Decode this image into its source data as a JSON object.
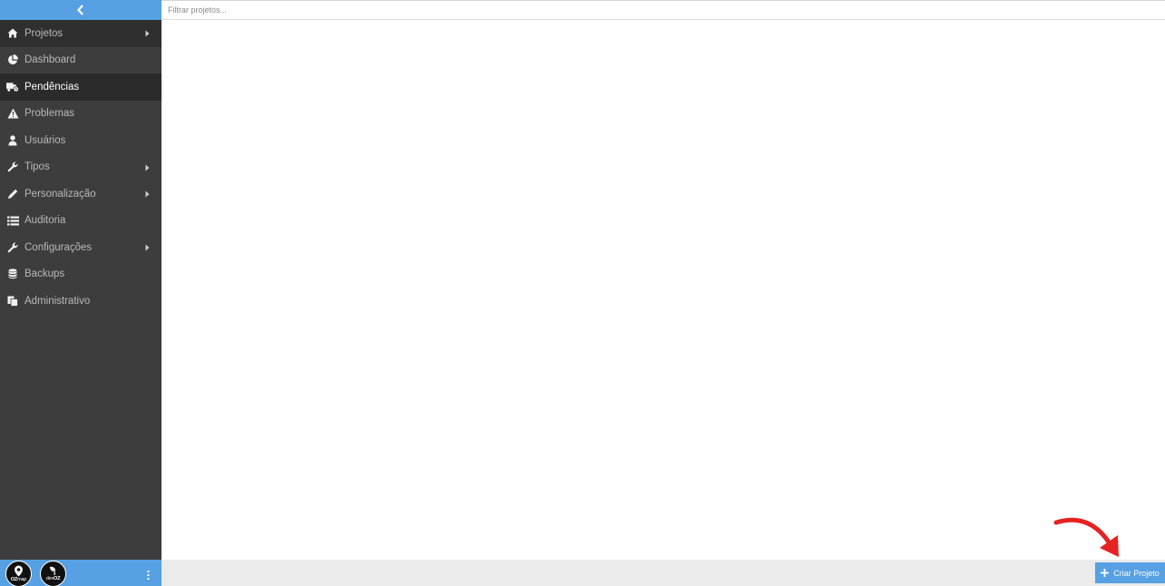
{
  "search": {
    "placeholder": "Filtrar projetos..."
  },
  "sidebar": {
    "items": [
      {
        "label": "Projetos",
        "icon": "home-icon",
        "has_submenu": true
      },
      {
        "label": "Dashboard",
        "icon": "pie-chart-icon",
        "has_submenu": false
      },
      {
        "label": "Pendências",
        "icon": "truck-clock-icon",
        "has_submenu": false,
        "active": true
      },
      {
        "label": "Problemas",
        "icon": "warning-icon",
        "has_submenu": false
      },
      {
        "label": "Usuários",
        "icon": "user-icon",
        "has_submenu": false
      },
      {
        "label": "Tipos",
        "icon": "wrench-icon",
        "has_submenu": true
      },
      {
        "label": "Personalização",
        "icon": "pencil-icon",
        "has_submenu": true
      },
      {
        "label": "Auditoria",
        "icon": "list-icon",
        "has_submenu": false
      },
      {
        "label": "Configurações",
        "icon": "wrench-icon",
        "has_submenu": true
      },
      {
        "label": "Backups",
        "icon": "database-icon",
        "has_submenu": false
      },
      {
        "label": "Administrativo",
        "icon": "copy-icon",
        "has_submenu": false
      }
    ]
  },
  "footer": {
    "logos": [
      {
        "name": "OZmap",
        "text_main": "OZ",
        "text_sub": "map"
      },
      {
        "name": "devOZ",
        "text_main": "OZ",
        "text_sub": "dev"
      }
    ],
    "create_button_label": "Criar Projeto"
  },
  "colors": {
    "sidebar_bg": "#3d3d3d",
    "accent_blue": "#56a0e3",
    "active_item_bg": "#2b2b2b",
    "annotation_arrow": "#e62222"
  }
}
